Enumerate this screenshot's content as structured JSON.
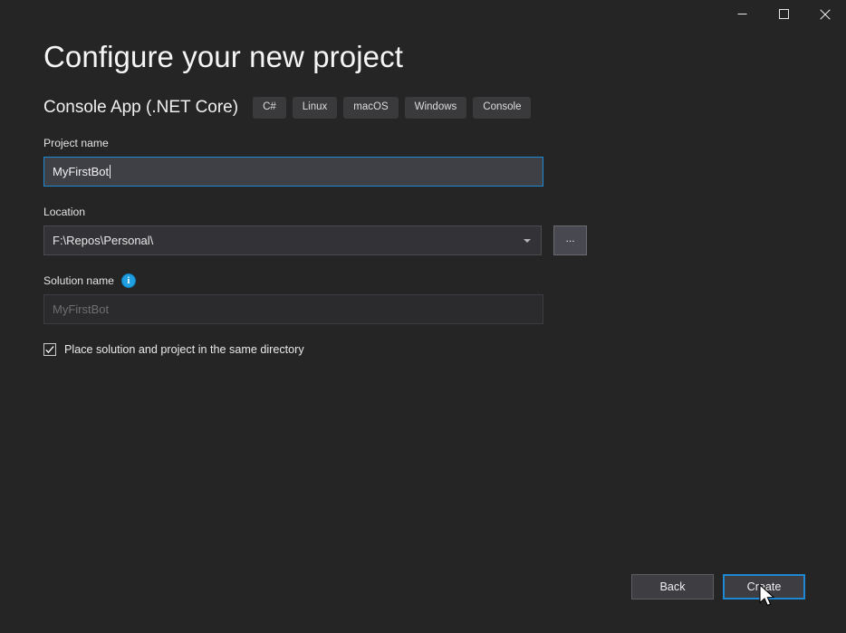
{
  "window": {
    "controls": [
      {
        "name": "minimize",
        "glyph": "minimize-icon"
      },
      {
        "name": "maximize",
        "glyph": "maximize-icon"
      },
      {
        "name": "close",
        "glyph": "close-icon"
      }
    ]
  },
  "header": {
    "title": "Configure your new project",
    "subtitle": "Console App (.NET Core)",
    "tags": [
      "C#",
      "Linux",
      "macOS",
      "Windows",
      "Console"
    ]
  },
  "form": {
    "project_name": {
      "label": "Project name",
      "value": "MyFirstBot"
    },
    "location": {
      "label": "Location",
      "value": "F:\\Repos\\Personal\\",
      "browse_label": "..."
    },
    "solution_name": {
      "label": "Solution name",
      "info_glyph": "i",
      "placeholder": "MyFirstBot",
      "value": ""
    },
    "same_directory": {
      "label": "Place solution and project in the same directory",
      "checked": true
    }
  },
  "footer": {
    "back_label": "Back",
    "create_label": "Create"
  },
  "colors": {
    "background": "#252526",
    "accent": "#1d89d4",
    "input_fill": "#3f3f46",
    "info_blue": "#1f9fe0",
    "tag_fill": "#3a3a3c"
  }
}
